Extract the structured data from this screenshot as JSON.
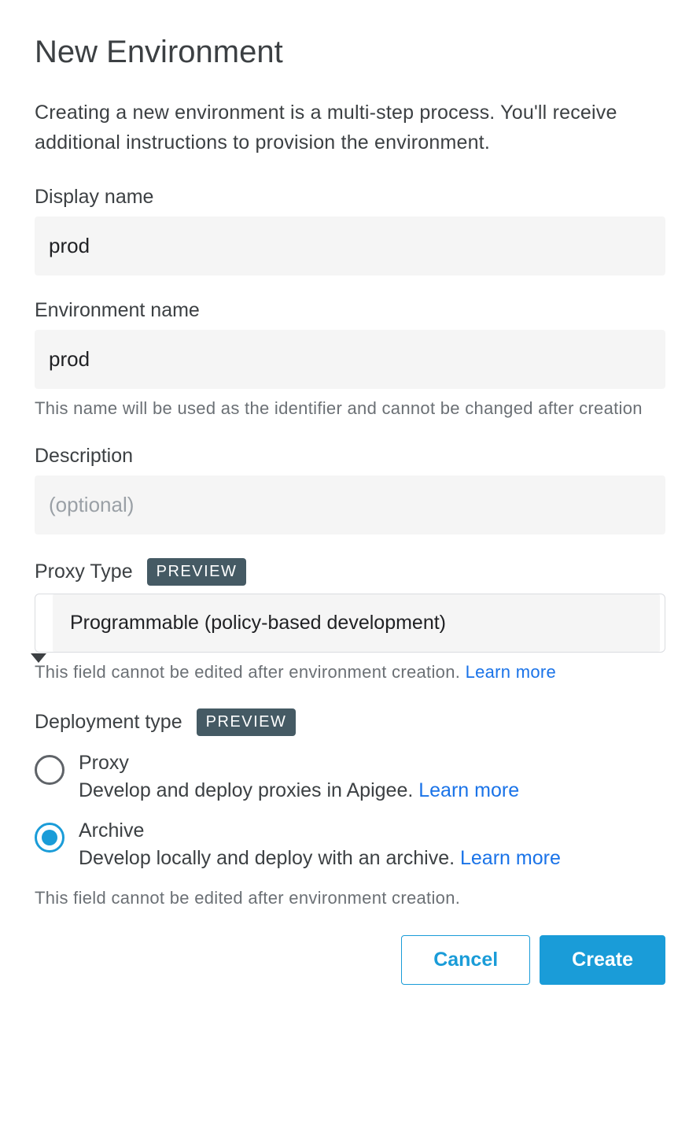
{
  "title": "New Environment",
  "intro": "Creating a new environment is a multi-step process. You'll receive additional instructions to provision the environment.",
  "display_name": {
    "label": "Display name",
    "value": "prod"
  },
  "environment_name": {
    "label": "Environment name",
    "value": "prod",
    "helper": "This name will be used as the identifier and cannot be changed after creation"
  },
  "description": {
    "label": "Description",
    "value": "",
    "placeholder": "(optional)"
  },
  "proxy_type": {
    "label": "Proxy Type",
    "badge": "PREVIEW",
    "selected": "Programmable (policy-based development)",
    "helper_text": "This field cannot be edited after environment creation. ",
    "helper_link": "Learn more"
  },
  "deployment_type": {
    "label": "Deployment type",
    "badge": "PREVIEW",
    "options": [
      {
        "title": "Proxy",
        "desc": "Develop and deploy proxies in Apigee. ",
        "link": "Learn more",
        "selected": false
      },
      {
        "title": "Archive",
        "desc": "Develop locally and deploy with an archive. ",
        "link": "Learn more",
        "selected": true
      }
    ],
    "footer": "This field cannot be edited after environment creation."
  },
  "actions": {
    "cancel": "Cancel",
    "create": "Create"
  }
}
